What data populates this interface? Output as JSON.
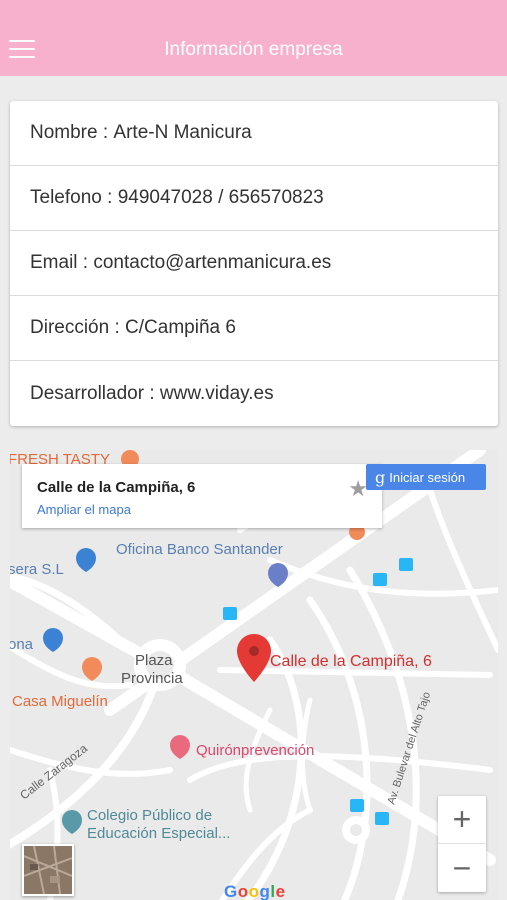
{
  "header": {
    "title": "Información empresa",
    "menu_icon": "hamburger-menu-icon",
    "background": "#f8b1cd"
  },
  "info": {
    "rows": [
      {
        "label": "Nombre",
        "value": "Arte-N Manicura"
      },
      {
        "label": "Telefono",
        "value": "949047028 / 656570823"
      },
      {
        "label": "Email",
        "value": "contacto@artenmanicura.es"
      },
      {
        "label": "Dirección",
        "value": "C/Campiña 6"
      },
      {
        "label": "Desarrollador",
        "value": "www.viday.es"
      }
    ],
    "separator": " : "
  },
  "map": {
    "place_card": {
      "title": "Calle de la Campiña, 6",
      "link": "Ampliar el mapa",
      "star_icon": "star-icon"
    },
    "signin": {
      "g": "g",
      "label": "Iniciar sesión"
    },
    "zoom": {
      "plus": "+",
      "minus": "−"
    },
    "labels": {
      "fresh_tasty": "FRESH TASTY",
      "oficina": "Oficina Banco Santander",
      "sera": "sera S.L",
      "ona": "ona",
      "plaza": "Plaza",
      "provincia": "Provincia",
      "casa": "Casa Miguelín",
      "marker": "Calle de la Campiña, 6",
      "quiron": "Quirónprevención",
      "zaragoza": "Calle Zaragoza",
      "bulevar": "Av. Bulevar del Alto Tajo",
      "colegio1": "Colegio Público de",
      "colegio2": "Educación Especial...",
      "google": "Google"
    },
    "accent_red": "#e53935",
    "accent_blue": "#4a86e8"
  }
}
